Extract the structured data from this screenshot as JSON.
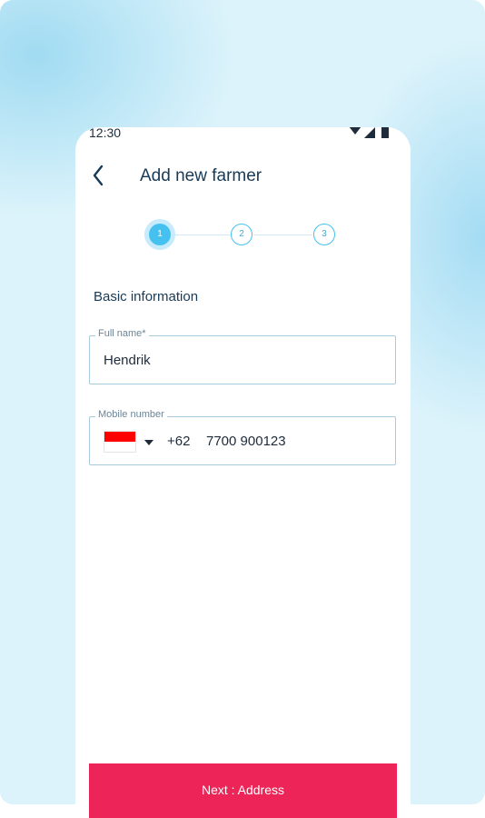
{
  "status_bar": {
    "time": "12:30",
    "icons": [
      "wifi-icon",
      "signal-icon",
      "battery-icon"
    ]
  },
  "header": {
    "back_icon": "chevron-left-icon",
    "title": "Add new farmer"
  },
  "stepper": {
    "steps": [
      "1",
      "2",
      "3"
    ],
    "active_step": 1
  },
  "form": {
    "section_title": "Basic information",
    "full_name": {
      "label": "Full name*",
      "value": "Hendrik"
    },
    "mobile": {
      "label": "Mobile number",
      "flag_icon": "indonesia-flag-icon",
      "dial_code": "+62",
      "value": "7700 900123"
    }
  },
  "footer": {
    "next_label": "Next : Address"
  },
  "colors": {
    "accent": "#45c1f0",
    "primary_button": "#ec2457",
    "title_text": "#173a57",
    "background": "#dcf3fb"
  }
}
